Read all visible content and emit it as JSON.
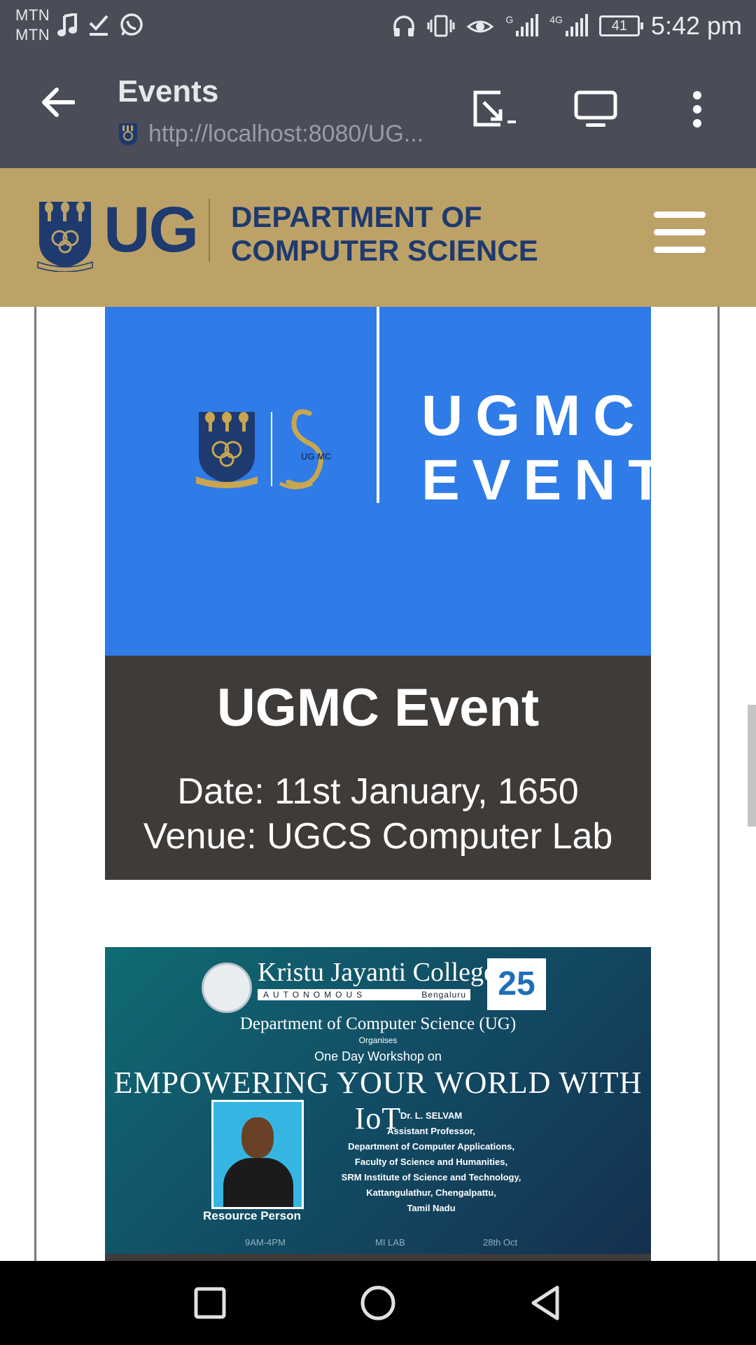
{
  "status_bar": {
    "carrier_1": "MTN",
    "carrier_2": "MTN",
    "network_label_1": "G",
    "network_label_2": "4G",
    "battery": "41",
    "time": "5:42 pm"
  },
  "browser": {
    "page_title": "Events",
    "url": "http://localhost:8080/UG..."
  },
  "site_header": {
    "logo_text": "UG",
    "dept_line_1": "DEPARTMENT OF",
    "dept_line_2": "COMPUTER SCIENCE"
  },
  "events": [
    {
      "banner_line_1": "UGMC",
      "banner_line_2": "EVENT",
      "banner_mark": "UG MC",
      "title": "UGMC Event",
      "date": "Date: 11st January, 1650",
      "venue": "Venue: UGCS Computer Lab"
    },
    {
      "poster_college": "Kristu Jayanti College",
      "poster_autonomous": "AUTONOMOUS",
      "poster_city": "Bengaluru",
      "poster_badge": "25",
      "poster_dept": "Department of Computer Science (UG)",
      "poster_organises": "Organises",
      "poster_workshop": "One Day Workshop on",
      "poster_headline": "EMPOWERING YOUR WORLD WITH IoT",
      "speaker_name": "Dr. L. SELVAM",
      "speaker_role": "Assistant Professor,",
      "speaker_dept": "Department of Computer Applications,",
      "speaker_faculty": "Faculty of Science and Humanities,",
      "speaker_inst": "SRM Institute of Science and Technology,",
      "speaker_place": "Kattangulathur, Chengalpattu,",
      "speaker_state": "Tamil Nadu",
      "resource_label": "Resource Person",
      "time": "9AM-4PM",
      "venue": "MI LAB",
      "date": "28th Oct"
    }
  ],
  "colors": {
    "system_bar": "#4a4d57",
    "header_gold": "#bda268",
    "brand_navy": "#1e3a6e",
    "banner_blue": "#2f7be8",
    "card_dark": "#3e3b39"
  }
}
